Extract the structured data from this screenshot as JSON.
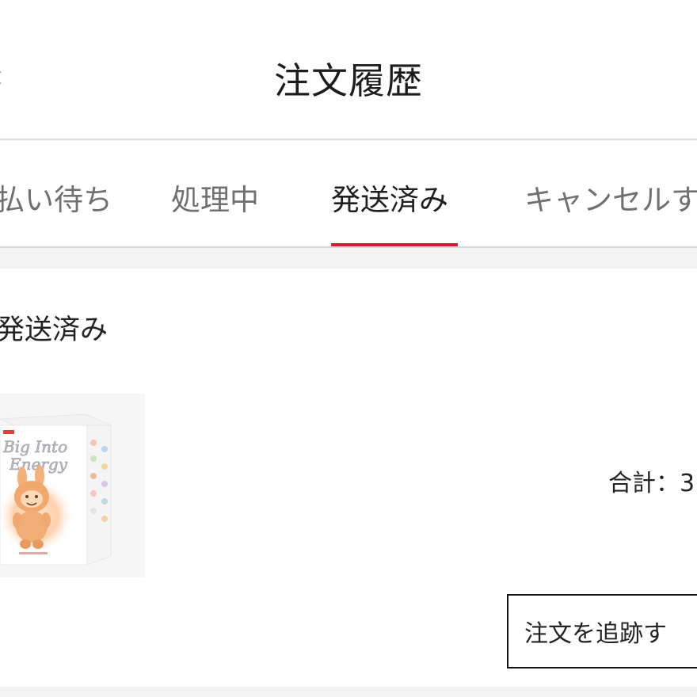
{
  "header": {
    "title": "注文履歴"
  },
  "tabs": [
    {
      "label": "支払い待ち",
      "active": false
    },
    {
      "label": "処理中",
      "active": false
    },
    {
      "label": "発送済み",
      "active": true
    },
    {
      "label": "キャンセルす",
      "active": false
    }
  ],
  "order": {
    "status": "発送済み",
    "total_label": "合計：3",
    "track_button_label": "注文を追跡す",
    "product": {
      "box_text": "Big Into Energy",
      "accent_color": "#f0b27a"
    }
  },
  "colors": {
    "accent": "#d21f33",
    "divider": "#dcdcdc",
    "background_band": "#f3f3f3"
  }
}
